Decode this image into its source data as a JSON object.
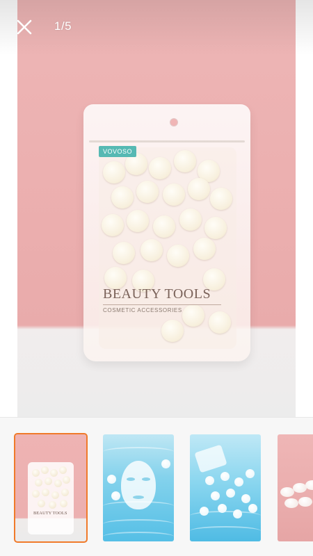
{
  "viewer": {
    "counter": "1/5",
    "product": {
      "brand": "VOVOSO",
      "title": "BEAUTY TOOLS",
      "subtitle": "COSMETIC ACCESSORIES"
    }
  },
  "controls": {
    "close_icon": "close-icon"
  },
  "thumbnails": [
    {
      "name": "pouch-on-pink",
      "selected": true
    },
    {
      "name": "face-mask-in-water",
      "selected": false
    },
    {
      "name": "tablets-in-water",
      "selected": false
    },
    {
      "name": "tablets-on-pink",
      "selected": false
    }
  ],
  "colors": {
    "accent": "#f07a2a",
    "background_pink": "#ebaeae",
    "brand_tag": "#56b9b3"
  }
}
